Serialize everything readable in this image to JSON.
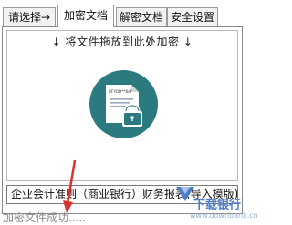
{
  "tabs": [
    {
      "label": "请选择→"
    },
    {
      "label": "加密文档"
    },
    {
      "label": "解密文档"
    },
    {
      "label": "安全设置"
    }
  ],
  "active_tab": 1,
  "dropzone": {
    "hint": "↓ 将文件拖放到此处加密 ↓",
    "icon": "encrypted-document-lock-icon",
    "doc_placeholder": "RFYOD**8dF",
    "accent_color": "#2b7a80"
  },
  "file_select": {
    "value": "企业会计准则（商业银行）财务报表(导入模版)"
  },
  "status": {
    "text": "加密文件成功....."
  },
  "watermark": {
    "text": "下载银行",
    "url": "www.downbank.cn"
  }
}
